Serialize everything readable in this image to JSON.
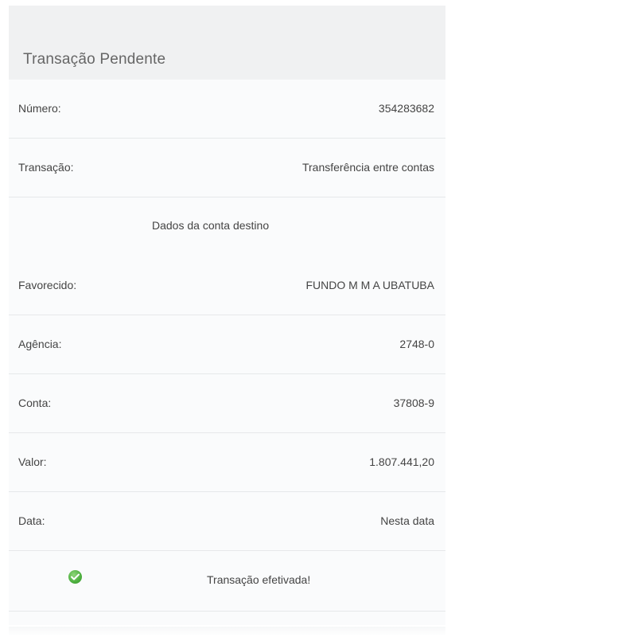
{
  "panel": {
    "title": "Transação Pendente"
  },
  "rows": {
    "numero": {
      "label": "Número:",
      "value": "354283682"
    },
    "transacao": {
      "label": "Transação:",
      "value": "Transferência entre contas"
    },
    "section_title": "Dados da conta destino",
    "favorecido": {
      "label": "Favorecido:",
      "value": "FUNDO M M A UBATUBA"
    },
    "agencia": {
      "label": "Agência:",
      "value": "2748-0"
    },
    "conta": {
      "label": "Conta:",
      "value": "37808-9"
    },
    "valor": {
      "label": "Valor:",
      "value": "1.807.441,20"
    },
    "data": {
      "label": "Data:",
      "value": "Nesta data"
    }
  },
  "status": {
    "icon": "check-circle-icon",
    "text": "Transação efetivada!",
    "color": "#4caf3e"
  }
}
